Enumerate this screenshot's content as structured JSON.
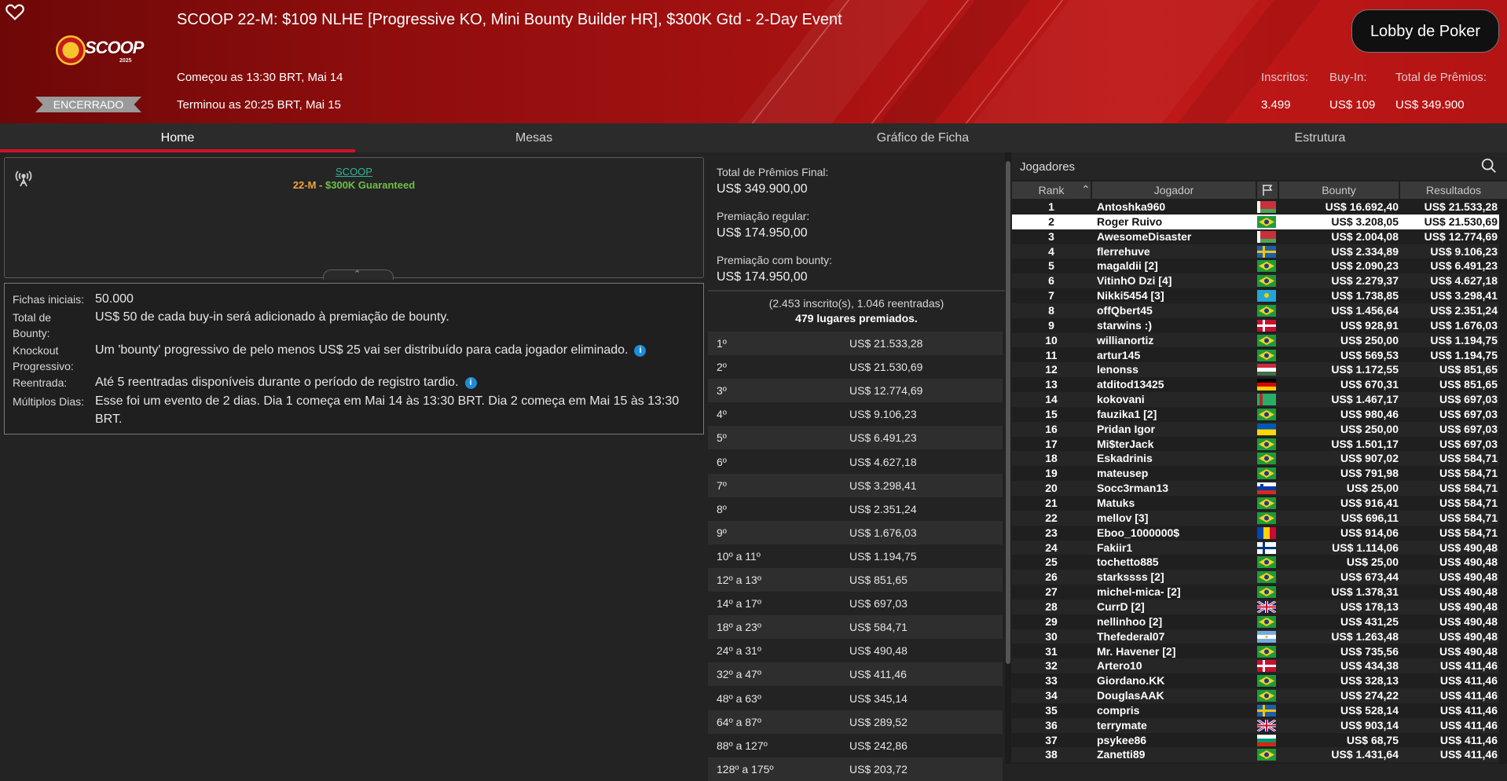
{
  "header": {
    "title": "SCOOP 22-M: $109 NLHE [Progressive KO, Mini Bounty Builder HR], $300K Gtd - 2-Day Event",
    "status": "ENCERRADO",
    "started": "Começou as 13:30 BRT, Mai 14",
    "ended": "Terminou as 20:25 BRT, Mai 15",
    "lobby_button": "Lobby de Poker",
    "logo_word": "SCOOP",
    "logo_year": "2025",
    "stats": {
      "entrants_label": "Inscritos:",
      "entrants_value": "3.499",
      "buyin_label": "Buy-In:",
      "buyin_value": "US$ 109",
      "prize_label": "Total de Prêmios:",
      "prize_value": "US$ 349.900"
    },
    "colors": {
      "header_red": "#a81212",
      "lobby_button_bg": "#101010"
    }
  },
  "tabs": [
    {
      "label": "Home",
      "active": true
    },
    {
      "label": "Mesas",
      "active": false
    },
    {
      "label": "Gráfico de Ficha",
      "active": false
    },
    {
      "label": "Estrutura",
      "active": false
    }
  ],
  "info_box": {
    "link": "SCOOP",
    "event_number": "22-M",
    "separator": " - ",
    "guarantee": "$300K Guaranteed",
    "icon": "antenna-icon"
  },
  "details": {
    "starting_chips_label": "Fichas iniciais:",
    "starting_chips": "50.000",
    "bounty_total_label": "Total de Bounty:",
    "bounty_total": "US$ 50 de cada buy-in será adicionado à premiação de bounty.",
    "knockout_label": "Knockout Progressivo:",
    "knockout": "Um 'bounty' progressivo de pelo menos US$ 25 vai ser distribuído para cada jogador eliminado.",
    "reentry_label": "Reentrada:",
    "reentry": "Até 5 reentradas disponíveis durante o período de registro tardio.",
    "multiday_label": "Múltiplos Dias:",
    "multiday": "Esse foi um evento de 2 dias. Dia 1 começa em Mai 14 às 13:30 BRT. Dia 2 começa em Mai 15 às 13:30 BRT."
  },
  "prizes": {
    "total_label": "Total de Prêmios Final:",
    "total_value": "US$ 349.900,00",
    "regular_label": "Premiação regular:",
    "regular_value": "US$ 174.950,00",
    "bounty_label": "Premiação com bounty:",
    "bounty_value": "US$ 174.950,00",
    "entrants_text": "(2.453 inscrito(s), 1.046 reentradas)",
    "paid_text": "479 lugares premiados.",
    "rows": [
      {
        "place": "1º",
        "amount": "US$ 21.533,28"
      },
      {
        "place": "2º",
        "amount": "US$ 21.530,69"
      },
      {
        "place": "3º",
        "amount": "US$ 12.774,69"
      },
      {
        "place": "4º",
        "amount": "US$ 9.106,23"
      },
      {
        "place": "5º",
        "amount": "US$ 6.491,23"
      },
      {
        "place": "6º",
        "amount": "US$ 4.627,18"
      },
      {
        "place": "7º",
        "amount": "US$ 3.298,41"
      },
      {
        "place": "8º",
        "amount": "US$ 2.351,24"
      },
      {
        "place": "9º",
        "amount": "US$ 1.676,03"
      },
      {
        "place": "10º a 11º",
        "amount": "US$ 1.194,75"
      },
      {
        "place": "12º a 13º",
        "amount": "US$ 851,65"
      },
      {
        "place": "14º a 17º",
        "amount": "US$ 697,03"
      },
      {
        "place": "18º a 23º",
        "amount": "US$ 584,71"
      },
      {
        "place": "24º a 31º",
        "amount": "US$ 490,48"
      },
      {
        "place": "32º a 47º",
        "amount": "US$ 411,46"
      },
      {
        "place": "48º a 63º",
        "amount": "US$ 345,14"
      },
      {
        "place": "64º a 87º",
        "amount": "US$ 289,52"
      },
      {
        "place": "88º a 127º",
        "amount": "US$ 242,86"
      },
      {
        "place": "128º a 175º",
        "amount": "US$ 203,72"
      }
    ]
  },
  "players": {
    "title": "Jogadores",
    "columns": {
      "rank": "Rank",
      "player": "Jogador",
      "bounty": "Bounty",
      "results": "Resultados"
    },
    "rows": [
      {
        "rank": "1",
        "name": "Antoshka960",
        "flag": "by",
        "bounty": "US$ 16.692,40",
        "result": "US$ 21.533,28"
      },
      {
        "rank": "2",
        "name": "Roger Ruivo",
        "flag": "br",
        "bounty": "US$ 3.208,05",
        "result": "US$ 21.530,69",
        "selected": true
      },
      {
        "rank": "3",
        "name": "AwesomeDisaster",
        "flag": "by",
        "bounty": "US$ 2.004,08",
        "result": "US$ 12.774,69"
      },
      {
        "rank": "4",
        "name": "flerrehuve",
        "flag": "se",
        "bounty": "US$ 2.334,89",
        "result": "US$ 9.106,23"
      },
      {
        "rank": "5",
        "name": "magaldii [2]",
        "flag": "br",
        "bounty": "US$ 2.090,23",
        "result": "US$ 6.491,23"
      },
      {
        "rank": "6",
        "name": "VitinhO Dzi [4]",
        "flag": "br",
        "bounty": "US$ 2.279,37",
        "result": "US$ 4.627,18"
      },
      {
        "rank": "7",
        "name": "Nikki5454 [3]",
        "flag": "kz",
        "bounty": "US$ 1.738,85",
        "result": "US$ 3.298,41"
      },
      {
        "rank": "8",
        "name": "offQbert45",
        "flag": "br",
        "bounty": "US$ 1.456,64",
        "result": "US$ 2.351,24"
      },
      {
        "rank": "9",
        "name": "starwins :)",
        "flag": "dk",
        "bounty": "US$ 928,91",
        "result": "US$ 1.676,03"
      },
      {
        "rank": "10",
        "name": "willianortiz",
        "flag": "br",
        "bounty": "US$ 250,00",
        "result": "US$ 1.194,75"
      },
      {
        "rank": "11",
        "name": "artur145",
        "flag": "br",
        "bounty": "US$ 569,53",
        "result": "US$ 1.194,75"
      },
      {
        "rank": "12",
        "name": "lenonss",
        "flag": "hu",
        "bounty": "US$ 1.172,55",
        "result": "US$ 851,65"
      },
      {
        "rank": "13",
        "name": "atditod13425",
        "flag": "de",
        "bounty": "US$ 670,31",
        "result": "US$ 851,65"
      },
      {
        "rank": "14",
        "name": "kokovani",
        "flag": "tm",
        "bounty": "US$ 1.467,17",
        "result": "US$ 697,03"
      },
      {
        "rank": "15",
        "name": "fauzika1 [2]",
        "flag": "br",
        "bounty": "US$ 980,46",
        "result": "US$ 697,03"
      },
      {
        "rank": "16",
        "name": "Pridan Igor",
        "flag": "ua",
        "bounty": "US$ 250,00",
        "result": "US$ 697,03"
      },
      {
        "rank": "17",
        "name": "Mi$terJack",
        "flag": "br",
        "bounty": "US$ 1.501,17",
        "result": "US$ 697,03"
      },
      {
        "rank": "18",
        "name": "Eskadrinis",
        "flag": "br",
        "bounty": "US$ 907,02",
        "result": "US$ 584,71"
      },
      {
        "rank": "19",
        "name": "mateusep",
        "flag": "br",
        "bounty": "US$ 791,98",
        "result": "US$ 584,71"
      },
      {
        "rank": "20",
        "name": "Socc3rman13",
        "flag": "si",
        "bounty": "US$ 25,00",
        "result": "US$ 584,71"
      },
      {
        "rank": "21",
        "name": "Matuks",
        "flag": "br",
        "bounty": "US$ 916,41",
        "result": "US$ 584,71"
      },
      {
        "rank": "22",
        "name": "mellov [3]",
        "flag": "br",
        "bounty": "US$ 696,11",
        "result": "US$ 584,71"
      },
      {
        "rank": "23",
        "name": "Eboo_1000000$",
        "flag": "md",
        "bounty": "US$ 914,06",
        "result": "US$ 584,71"
      },
      {
        "rank": "24",
        "name": "Fakiir1",
        "flag": "fi",
        "bounty": "US$ 1.114,06",
        "result": "US$ 490,48"
      },
      {
        "rank": "25",
        "name": "tochetto885",
        "flag": "br",
        "bounty": "US$ 25,00",
        "result": "US$ 490,48"
      },
      {
        "rank": "26",
        "name": "starkssss [2]",
        "flag": "br",
        "bounty": "US$ 673,44",
        "result": "US$ 490,48"
      },
      {
        "rank": "27",
        "name": "michel-mica- [2]",
        "flag": "br",
        "bounty": "US$ 1.378,31",
        "result": "US$ 490,48"
      },
      {
        "rank": "28",
        "name": "CurrD [2]",
        "flag": "gb",
        "bounty": "US$ 178,13",
        "result": "US$ 490,48"
      },
      {
        "rank": "29",
        "name": "nellinhoo [2]",
        "flag": "br",
        "bounty": "US$ 431,25",
        "result": "US$ 490,48"
      },
      {
        "rank": "30",
        "name": "Thefederal07",
        "flag": "ar",
        "bounty": "US$ 1.263,48",
        "result": "US$ 490,48"
      },
      {
        "rank": "31",
        "name": "Mr. Havener [2]",
        "flag": "br",
        "bounty": "US$ 735,56",
        "result": "US$ 490,48"
      },
      {
        "rank": "32",
        "name": "Artero10",
        "flag": "dk",
        "bounty": "US$ 434,38",
        "result": "US$ 411,46"
      },
      {
        "rank": "33",
        "name": "Giordano.KK",
        "flag": "br",
        "bounty": "US$ 328,13",
        "result": "US$ 411,46"
      },
      {
        "rank": "34",
        "name": "DouglasAAK",
        "flag": "br",
        "bounty": "US$ 274,22",
        "result": "US$ 411,46"
      },
      {
        "rank": "35",
        "name": "compris",
        "flag": "se",
        "bounty": "US$ 528,14",
        "result": "US$ 411,46"
      },
      {
        "rank": "36",
        "name": "terrymate",
        "flag": "gb",
        "bounty": "US$ 903,14",
        "result": "US$ 411,46"
      },
      {
        "rank": "37",
        "name": "psykee86",
        "flag": "bg",
        "bounty": "US$ 68,75",
        "result": "US$ 411,46"
      },
      {
        "rank": "38",
        "name": "Zanetti89",
        "flag": "br",
        "bounty": "US$ 1.431,64",
        "result": "US$ 411,46"
      }
    ]
  }
}
